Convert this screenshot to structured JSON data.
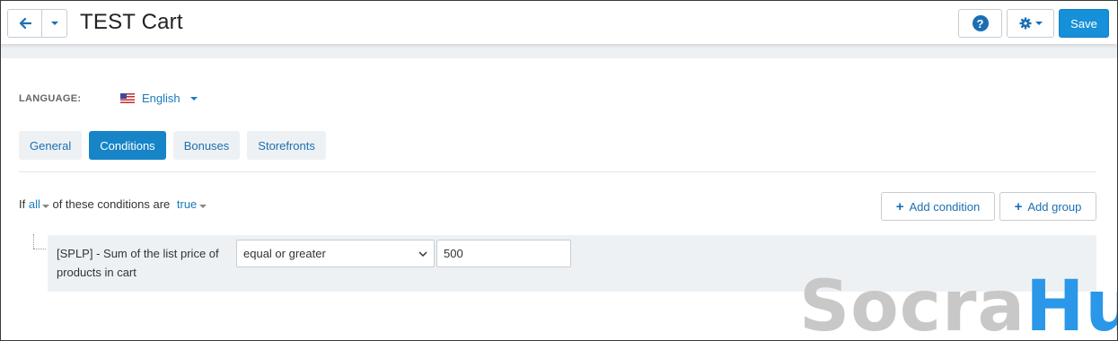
{
  "header": {
    "title": "TEST Cart",
    "help_label": "?",
    "save_label": "Save"
  },
  "language": {
    "label": "LANGUAGE:",
    "selected": "English"
  },
  "tabs": [
    {
      "label": "General",
      "active": false
    },
    {
      "label": "Conditions",
      "active": true
    },
    {
      "label": "Bonuses",
      "active": false
    },
    {
      "label": "Storefronts",
      "active": false
    }
  ],
  "conditions": {
    "prefix": "If ",
    "match_mode": "all",
    "middle": " of these conditions are ",
    "truth_value": "true",
    "add_condition_label": "Add condition",
    "add_group_label": "Add group",
    "items": [
      {
        "description": "[SPLP] - Sum of the list price of products in cart",
        "operator": "equal or greater",
        "value": "500"
      }
    ]
  },
  "watermark": {
    "part1": "Socra",
    "part2": "Hub"
  },
  "colors": {
    "accent": "#1690d8",
    "link": "#1a7bbf",
    "panel": "#eef1f4"
  }
}
